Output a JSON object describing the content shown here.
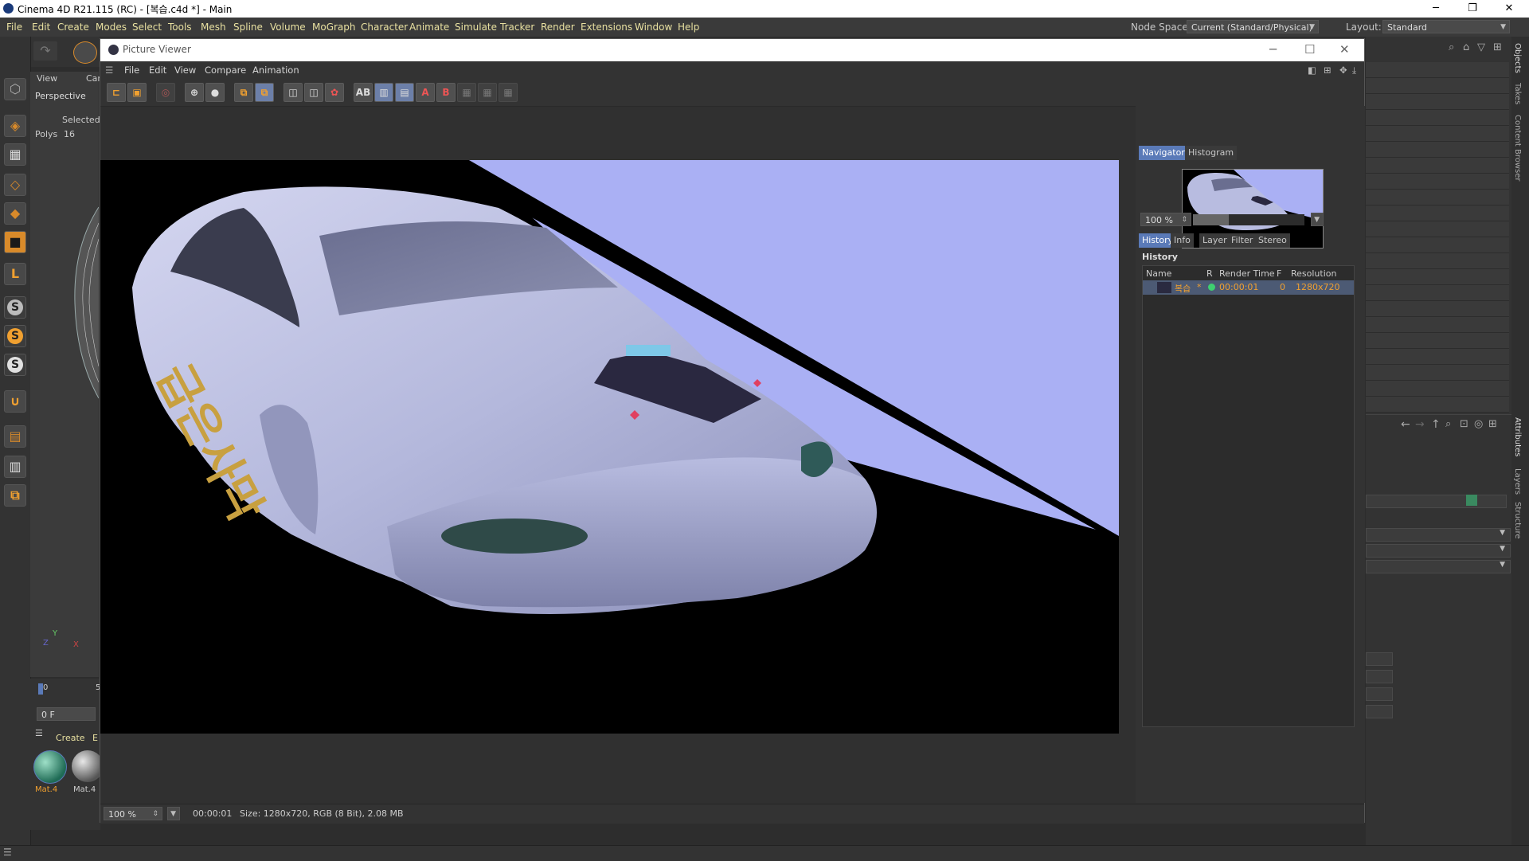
{
  "app": {
    "title": "Cinema 4D R21.115 (RC) - [복습.c4d *] - Main",
    "min": "─",
    "max": "❐",
    "close": "✕"
  },
  "menu": [
    "File",
    "Edit",
    "Create",
    "Modes",
    "Select",
    "Tools",
    "Mesh",
    "Spline",
    "Volume",
    "MoGraph",
    "Character",
    "Animate",
    "Simulate",
    "Tracker",
    "Render",
    "Extensions",
    "Window",
    "Help"
  ],
  "nodespace": {
    "label": "Node Space:",
    "value": "Current (Standard/Physical)"
  },
  "layout": {
    "label": "Layout:",
    "value": "Standard"
  },
  "viewport": {
    "menu_view": "View",
    "menu_cam": "Car",
    "name": "Perspective",
    "selected": "Selected",
    "polys_label": "Polys",
    "polys_value": "16",
    "axis_y": "Y",
    "axis_x": "X",
    "axis_z": "Z"
  },
  "timeline": {
    "start": "0",
    "tick": "5",
    "frame": "0 F"
  },
  "materials": {
    "create": "Create",
    "edit": "E",
    "items": [
      "Mat.4",
      "Mat.4"
    ]
  },
  "right_tabs": [
    "Objects",
    "Takes",
    "Content Browser",
    "Attributes",
    "Layers",
    "Structure"
  ],
  "picture_viewer": {
    "title": "Picture Viewer",
    "menu": [
      "File",
      "Edit",
      "View",
      "Compare",
      "Animation"
    ],
    "tabs_top": [
      "Navigator",
      "Histogram"
    ],
    "zoom": "100 %",
    "tabs_mid": [
      "History",
      "Info",
      "Layer",
      "Filter",
      "Stereo"
    ],
    "history_label": "History",
    "columns": {
      "name": "Name",
      "r": "R",
      "render_time": "Render Time",
      "f": "F",
      "resolution": "Resolution"
    },
    "history_row": {
      "name": "복습",
      "star": "*",
      "time": "00:00:01",
      "f": "0",
      "res": "1280x720"
    },
    "status": {
      "zoom": "100 %",
      "time": "00:00:01",
      "size": "Size: 1280x720, RGB (8 Bit), 2.08 MB"
    }
  },
  "render": {
    "decal_text": "급은사막"
  },
  "colors": {
    "accent_menu": "#e8e0a0",
    "tab_active": "#5a7ab8",
    "orange": "#f0a030",
    "car_body": "#b8bde0",
    "wall": "#aab0f4"
  }
}
